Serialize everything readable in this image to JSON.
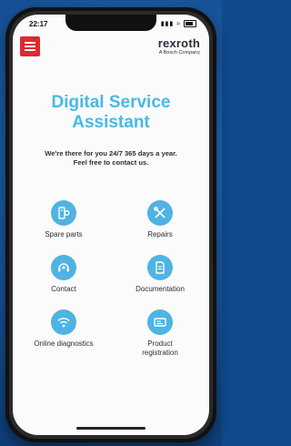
{
  "status": {
    "time": "22:17",
    "icons": "signal wifi battery"
  },
  "header": {
    "menu_icon": "hamburger-menu-icon",
    "brand_name": "rexroth",
    "brand_sub": "A Bosch Company",
    "menu_color": "#e0282f"
  },
  "main": {
    "title_line1": "Digital Service",
    "title_line2": "Assistant",
    "subtitle_line1": "We're there for you 24/7 365 days a year.",
    "subtitle_line2": "Feel free to contact us.",
    "accent_color": "#48b9e6",
    "tiles": [
      {
        "label": "Spare parts",
        "icon": "spare-parts-icon"
      },
      {
        "label": "Repairs",
        "icon": "wrench-screwdriver-icon"
      },
      {
        "label": "Contact",
        "icon": "headset-icon"
      },
      {
        "label": "Documentation",
        "icon": "document-icon"
      },
      {
        "label": "Online diagnostics",
        "icon": "wifi-diagnostics-icon"
      },
      {
        "label": "Product registration",
        "label_line1": "Product",
        "label_line2": "registration",
        "icon": "registration-card-icon"
      }
    ]
  }
}
